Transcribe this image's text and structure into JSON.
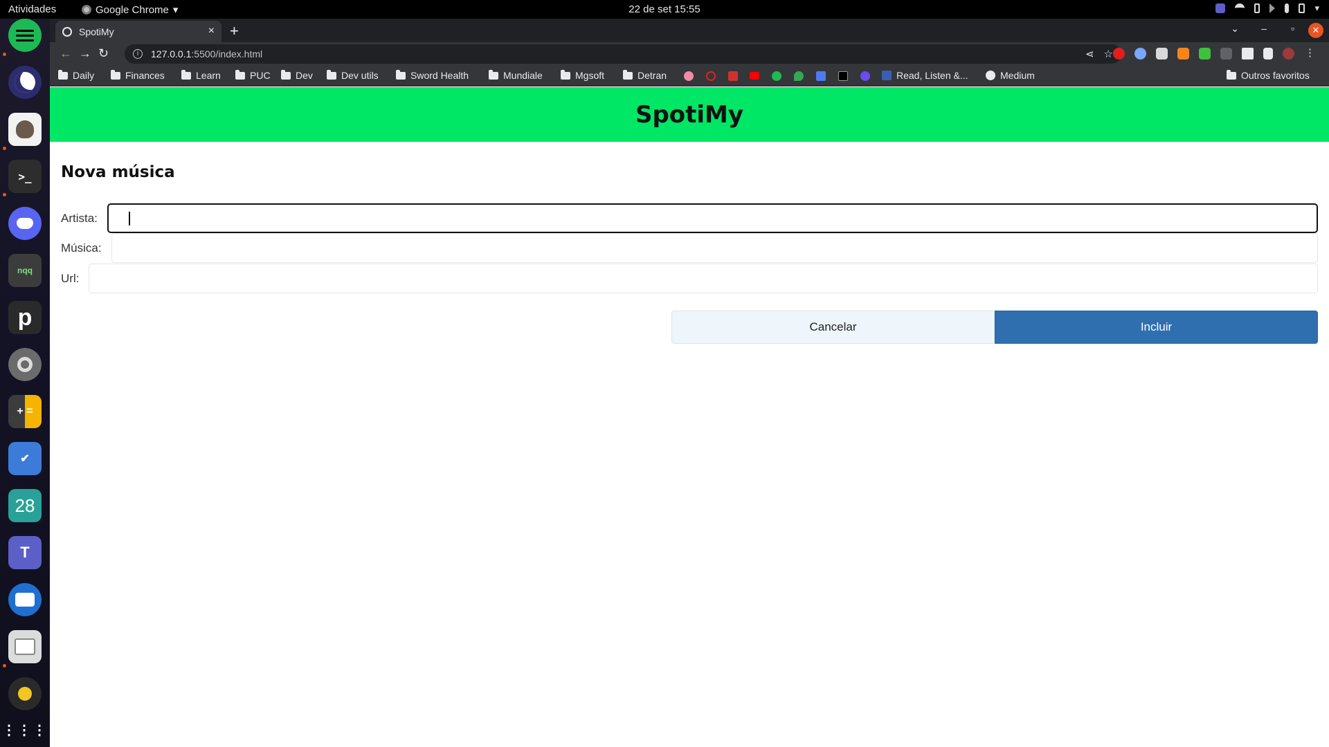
{
  "topbar": {
    "activities": "Atividades",
    "app_name": "Google Chrome",
    "app_menu_caret": "▾",
    "clock": "22 de set  15:55"
  },
  "browser": {
    "tab_title": "SpotiMy",
    "tab_close": "×",
    "new_tab": "+",
    "url_host": "127.0.0.1",
    "url_path": ":5500/index.html",
    "bookmarks": [
      "Daily",
      "Finances",
      "Learn",
      "PUC",
      "Dev",
      "Dev utils",
      "Sword Health",
      "Mundiale",
      "Mgsoft",
      "Detran"
    ],
    "bookmark_read_listen": "Read, Listen &...",
    "bookmark_medium": "Medium",
    "bookmark_others": "Outros favoritos"
  },
  "page": {
    "app_title": "SpotiMy",
    "form_title": "Nova música",
    "artist_label": "Artista:",
    "artist_value": "",
    "song_label": "Música:",
    "song_value": "",
    "url_label": "Url:",
    "url_value": "",
    "cancel_label": "Cancelar",
    "submit_label": "Incluir"
  },
  "colors": {
    "header_green": "#00e765",
    "submit_blue": "#2f6fb0",
    "cancel_bg": "#eef6fb"
  }
}
